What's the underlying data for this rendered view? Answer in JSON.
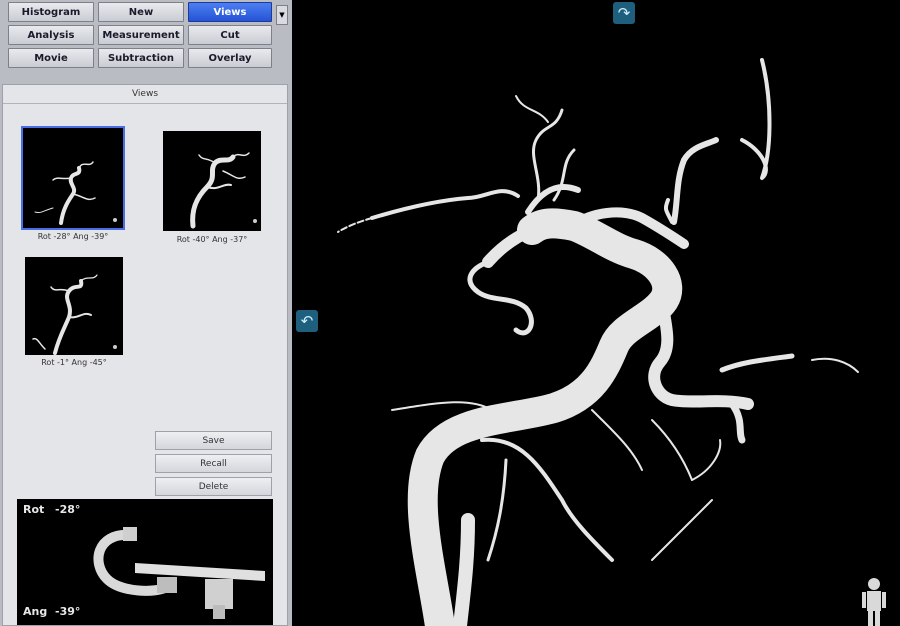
{
  "toolbar": {
    "row1": [
      "Histogram",
      "New",
      "Views"
    ],
    "row2": [
      "Analysis",
      "Measurement",
      "Cut"
    ],
    "row3": [
      "Movie",
      "Subtraction",
      "Overlay"
    ],
    "active": "Views",
    "menu_arrow_glyph": "▼"
  },
  "views_panel": {
    "title": "Views",
    "thumbnails": [
      {
        "caption": "Rot -28° Ang -39°",
        "selected": true
      },
      {
        "caption": "Rot -40° Ang -37°",
        "selected": false
      },
      {
        "caption": "Rot -1° Ang -45°",
        "selected": false
      }
    ],
    "buttons": {
      "save": "Save",
      "recall": "Recall",
      "delete": "Delete"
    }
  },
  "orientation": {
    "rot_label": "Rot",
    "rot_value": "-28°",
    "ang_label": "Ang",
    "ang_value": "-39°"
  },
  "viewport": {
    "rotate_top_glyph": "↷",
    "rotate_left_glyph": "↶"
  },
  "colors": {
    "vessel": "#e6e6e6",
    "active_button": "#2f5fe0",
    "nav_arrow": "#1f5f7e"
  }
}
